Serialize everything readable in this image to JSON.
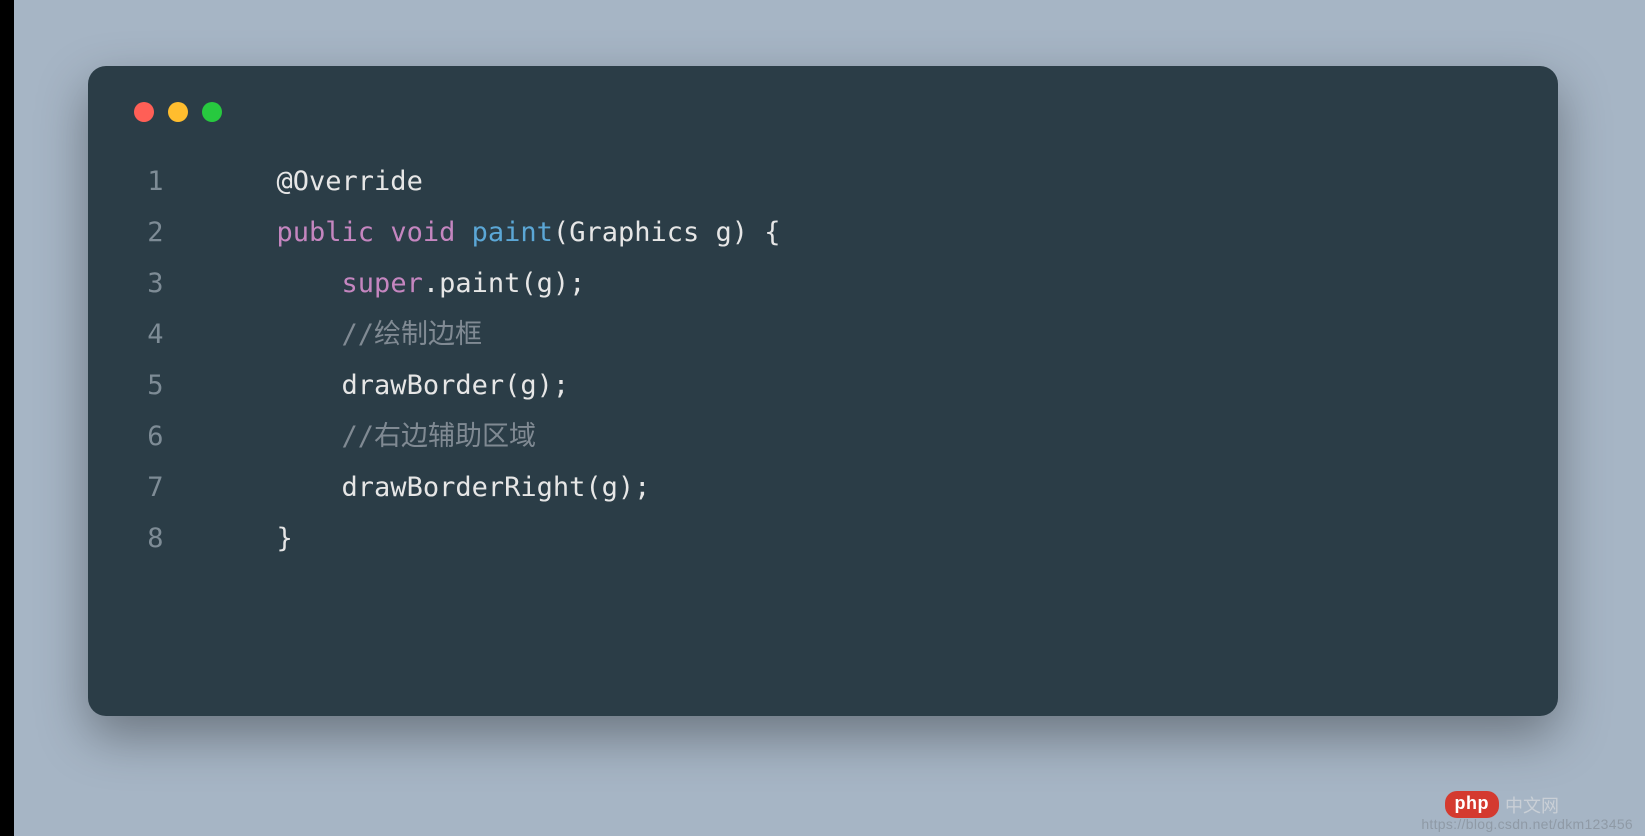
{
  "code": {
    "lines": [
      {
        "n": "1",
        "tokens": [
          {
            "cls": "tok-ann",
            "t": "    @Override"
          }
        ]
      },
      {
        "n": "2",
        "tokens": [
          {
            "cls": "",
            "t": "    "
          },
          {
            "cls": "tok-kw",
            "t": "public"
          },
          {
            "cls": "",
            "t": " "
          },
          {
            "cls": "tok-type",
            "t": "void"
          },
          {
            "cls": "",
            "t": " "
          },
          {
            "cls": "tok-fn",
            "t": "paint"
          },
          {
            "cls": "tok-punc",
            "t": "("
          },
          {
            "cls": "tok-cls",
            "t": "Graphics g"
          },
          {
            "cls": "tok-punc",
            "t": ") {"
          }
        ]
      },
      {
        "n": "3",
        "tokens": [
          {
            "cls": "",
            "t": "        "
          },
          {
            "cls": "tok-super",
            "t": "super"
          },
          {
            "cls": "tok-punc",
            "t": ".paint(g);"
          }
        ]
      },
      {
        "n": "4",
        "tokens": [
          {
            "cls": "",
            "t": "        "
          },
          {
            "cls": "tok-comm",
            "t": "//绘制边框"
          }
        ]
      },
      {
        "n": "5",
        "tokens": [
          {
            "cls": "",
            "t": "        drawBorder(g);"
          }
        ]
      },
      {
        "n": "6",
        "tokens": [
          {
            "cls": "",
            "t": "        "
          },
          {
            "cls": "tok-comm",
            "t": "//右边辅助区域"
          }
        ]
      },
      {
        "n": "7",
        "tokens": [
          {
            "cls": "",
            "t": "        drawBorderRight(g);"
          }
        ]
      },
      {
        "n": "8",
        "tokens": [
          {
            "cls": "",
            "t": "    }"
          }
        ]
      }
    ]
  },
  "watermark": {
    "badge": "php",
    "label": "中文网",
    "url": "https://blog.csdn.net/dkm123456"
  }
}
